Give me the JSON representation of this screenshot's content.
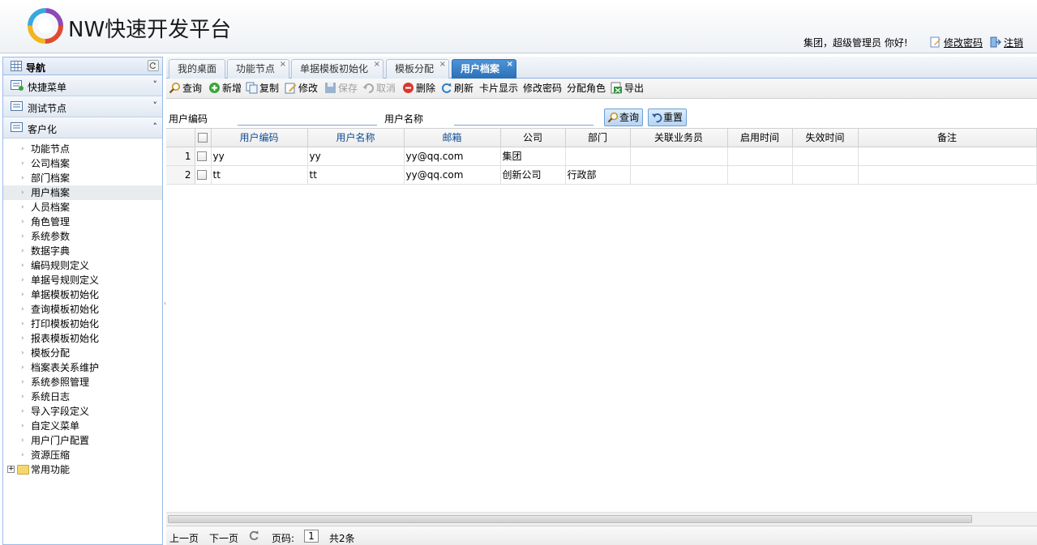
{
  "header": {
    "app_title": "NW快速开发平台",
    "user_info": "集团，超级管理员  你好!",
    "change_password": "修改密码",
    "logout": "注销"
  },
  "sidebar": {
    "title": "导航",
    "sections": [
      {
        "label": "快捷菜单",
        "chevron": "˅"
      },
      {
        "label": "测试节点",
        "chevron": "˅"
      },
      {
        "label": "客户化",
        "chevron": "˄"
      }
    ],
    "items": [
      "功能节点",
      "公司档案",
      "部门档案",
      "用户档案",
      "人员档案",
      "角色管理",
      "系统参数",
      "数据字典",
      "编码规则定义",
      "单据号规则定义",
      "单据模板初始化",
      "查询模板初始化",
      "打印模板初始化",
      "报表模板初始化",
      "模板分配",
      "档案表关系维护",
      "系统参照管理",
      "系统日志",
      "导入字段定义",
      "自定义菜单",
      "用户门户配置",
      "资源压缩"
    ],
    "selected_item": "用户档案",
    "folder": "常用功能"
  },
  "tabs": [
    {
      "label": "我的桌面"
    },
    {
      "label": "功能节点"
    },
    {
      "label": "单据模板初始化"
    },
    {
      "label": "模板分配"
    },
    {
      "label": "用户档案"
    }
  ],
  "toolbar": {
    "query": "查询",
    "add": "新增",
    "copy": "复制",
    "edit": "修改",
    "save": "保存",
    "cancel": "取消",
    "delete": "删除",
    "refresh": "刷新",
    "card_view": "卡片显示",
    "change_password": "修改密码",
    "assign_role": "分配角色",
    "export": "导出"
  },
  "search": {
    "user_code_label": "用户编码",
    "user_name_label": "用户名称",
    "user_code_value": "",
    "user_name_value": "",
    "query_button": "查询",
    "reset_button": "重置"
  },
  "grid": {
    "columns": [
      "用户编码",
      "用户名称",
      "邮箱",
      "公司",
      "部门",
      "关联业务员",
      "启用时间",
      "失效时间",
      "备注"
    ],
    "rows": [
      {
        "num": "1",
        "code": "yy",
        "name": "yy",
        "email": "yy@qq.com",
        "company": "集团",
        "dept": "",
        "salesman": "",
        "start": "",
        "end": "",
        "remark": ""
      },
      {
        "num": "2",
        "code": "tt",
        "name": "tt",
        "email": "yy@qq.com",
        "company": "创新公司",
        "dept": "行政部",
        "salesman": "",
        "start": "",
        "end": "",
        "remark": ""
      }
    ]
  },
  "pager": {
    "prev": "上一页",
    "next": "下一页",
    "page_label": "页码:",
    "page": "1",
    "total": "共2条"
  },
  "colors": {
    "accent": "#2b6fb8",
    "border": "#99bbe8",
    "header_link": "#0e4c92"
  }
}
